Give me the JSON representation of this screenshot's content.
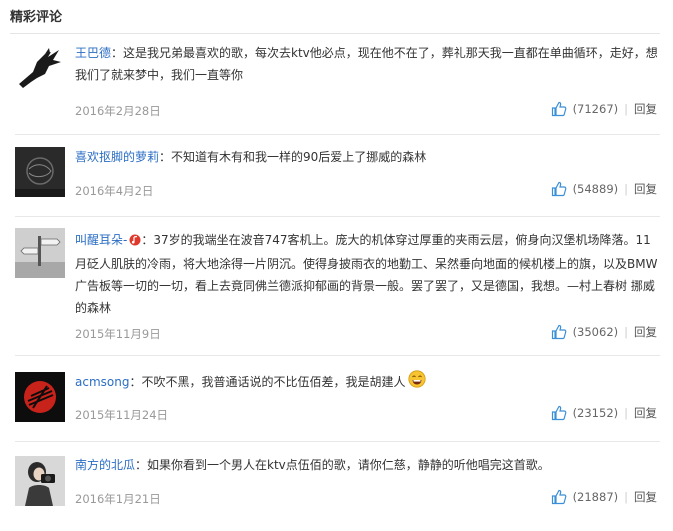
{
  "section": {
    "title": "精彩评论"
  },
  "colors": {
    "username": "#2b6ec4",
    "meta": "#999999",
    "like": "#3b8fd6"
  },
  "comments": [
    {
      "user": "王巴德",
      "sep": "：",
      "text": "这是我兄弟最喜欢的歌，每次去ktv他必点，现在他不在了，葬礼那天我一直都在单曲循环，走好，想我们了就来梦中，我们一直等你",
      "date": "2016年2月28日",
      "likes": "(71267)",
      "reply": "回复",
      "avatar": "crow-avatar"
    },
    {
      "user": "喜欢抠脚的萝莉",
      "sep": "：",
      "text": "不知道有木有和我一样的90后爱上了挪威的森林",
      "date": "2016年4月2日",
      "likes": "(54889)",
      "reply": "回复",
      "avatar": "dark-texture-avatar"
    },
    {
      "user": "叫醒耳朵-",
      "sep": "：",
      "text": "37岁的我端坐在波音747客机上。庞大的机体穿过厚重的夹雨云层，俯身向汉堡机场降落。11月砭人肌肤的冷雨，将大地涂得一片阴沉。使得身披雨衣的地勤工、呆然垂向地面的候机楼上的旗，以及BMW广告板等一切的一切，看上去竟同佛兰德派抑郁画的背景一般。罢了罢了，又是德国，我想。—村上春树 挪威的森林",
      "date": "2015年11月9日",
      "likes": "(35062)",
      "reply": "回复",
      "avatar": "signpost-avatar"
    },
    {
      "user": "acmsong",
      "sep": "：",
      "text": "不吹不黑，我普通话说的不比伍佰差，我是胡建人",
      "date": "2015年11月24日",
      "likes": "(23152)",
      "reply": "回复",
      "avatar": "red-logo-avatar"
    },
    {
      "user": "南方的北瓜",
      "sep": "：",
      "text": "如果你看到一个男人在ktv点伍佰的歌，请你仁慈，静静的听他唱完这首歌。",
      "date": "2016年1月21日",
      "likes": "(21887)",
      "reply": "回复",
      "avatar": "photographer-avatar"
    }
  ]
}
